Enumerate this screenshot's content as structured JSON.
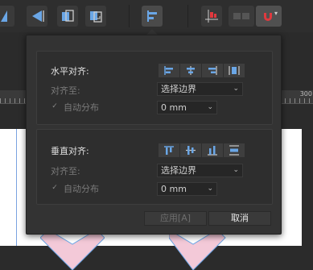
{
  "ruler": {
    "label": "300"
  },
  "dialog": {
    "horizontal": {
      "title": "水平对齐:",
      "align_to_label": "对齐至:",
      "align_to_value": "选择边界",
      "auto_distribute_label": "自动分布",
      "spacing_value": "0 mm"
    },
    "vertical": {
      "title": "垂直对齐:",
      "align_to_label": "对齐至:",
      "align_to_value": "选择边界",
      "auto_distribute_label": "自动分布",
      "spacing_value": "0 mm"
    },
    "apply_label": "应用[A]",
    "cancel_label": "取消"
  },
  "colors": {
    "accent_blue": "#6aa6e6",
    "snap_red": "#e0393e",
    "shape_pink": "#f3c9d8"
  },
  "icons": {
    "toolbar": [
      "flip-horizontal-icon",
      "flip-vertical-icon",
      "move-back-icon",
      "move-front-icon",
      "align-icon",
      "snapping-grid-icon",
      "toggle-icon",
      "magnet-icon"
    ],
    "horizontal_align": [
      "align-left-icon",
      "align-center-h-icon",
      "align-right-icon",
      "distribute-h-icon"
    ],
    "vertical_align": [
      "align-top-icon",
      "align-middle-v-icon",
      "align-bottom-icon",
      "distribute-v-icon"
    ]
  }
}
